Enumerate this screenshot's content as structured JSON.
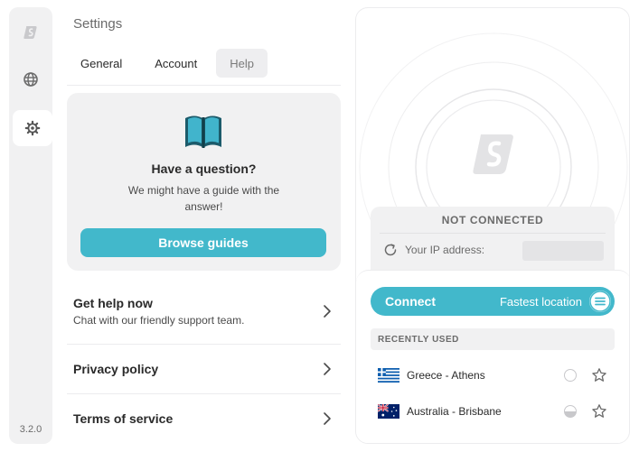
{
  "rail": {
    "items": [
      {
        "name": "surfshark-logo",
        "icon": "surfshark-logo-icon"
      },
      {
        "name": "locations",
        "icon": "globe-icon"
      },
      {
        "name": "settings",
        "icon": "gear-icon",
        "active": true
      }
    ],
    "version": "3.2.0"
  },
  "settings": {
    "title": "Settings",
    "tabs": [
      {
        "label": "General",
        "active": false
      },
      {
        "label": "Account",
        "active": false
      },
      {
        "label": "Help",
        "active": true
      }
    ]
  },
  "help_card": {
    "icon": "open-book-icon",
    "title": "Have a question?",
    "description": "We might have a guide with the answer!",
    "button_label": "Browse guides"
  },
  "links": [
    {
      "title": "Get help now",
      "subtitle": "Chat with our friendly support team."
    },
    {
      "title": "Privacy policy",
      "subtitle": ""
    },
    {
      "title": "Terms of service",
      "subtitle": ""
    }
  ],
  "vpn": {
    "status": "NOT CONNECTED",
    "ip_label": "Your IP address:",
    "connect_label": "Connect",
    "fastest_label": "Fastest location",
    "recent_header": "RECENTLY USED",
    "recent": [
      {
        "name": "Greece - Athens",
        "flag": "greece-flag-icon",
        "load": 0.0
      },
      {
        "name": "Australia - Brisbane",
        "flag": "australia-flag-icon",
        "load": 0.5
      }
    ]
  },
  "colors": {
    "accent": "#42b8cb",
    "panel": "#f1f1f2",
    "muted_text": "#6b6b6b"
  }
}
